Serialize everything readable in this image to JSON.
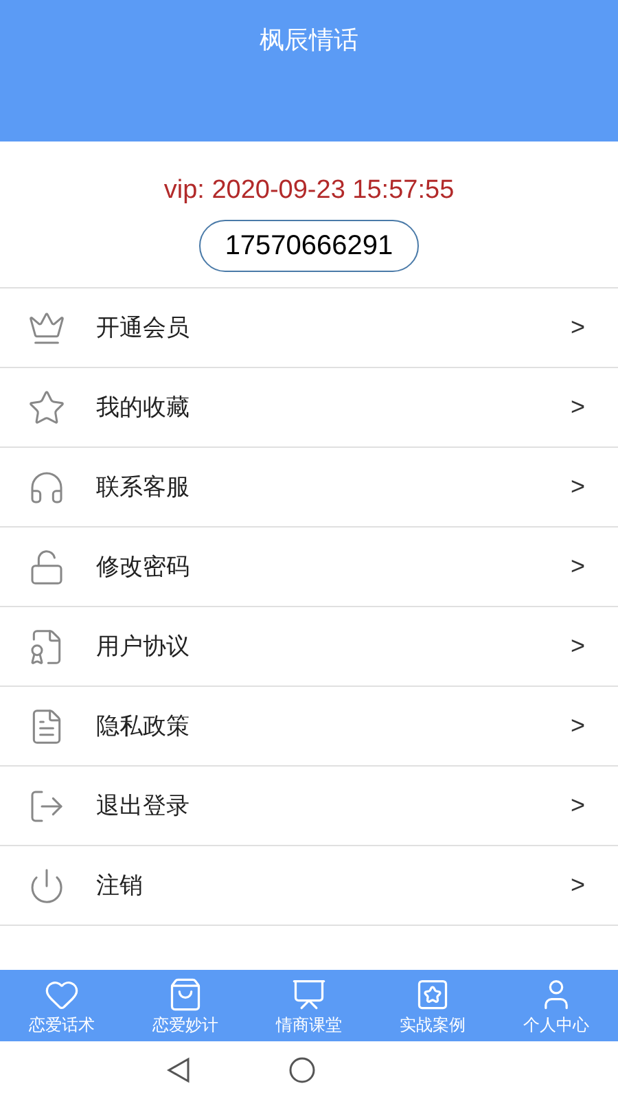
{
  "header": {
    "title": "枫辰情话"
  },
  "profile": {
    "vip": "vip: 2020-09-23 15:57:55",
    "phone": "17570666291"
  },
  "menu": [
    {
      "label": "开通会员",
      "arrow": ">"
    },
    {
      "label": "我的收藏",
      "arrow": ">"
    },
    {
      "label": "联系客服",
      "arrow": ">"
    },
    {
      "label": "修改密码",
      "arrow": ">"
    },
    {
      "label": "用户协议",
      "arrow": ">"
    },
    {
      "label": "隐私政策",
      "arrow": ">"
    },
    {
      "label": "退出登录",
      "arrow": ">"
    },
    {
      "label": "注销",
      "arrow": ">"
    }
  ],
  "tabs": [
    {
      "label": "恋爱话术"
    },
    {
      "label": "恋爱妙计"
    },
    {
      "label": "情商课堂"
    },
    {
      "label": "实战案例"
    },
    {
      "label": "个人中心"
    }
  ]
}
